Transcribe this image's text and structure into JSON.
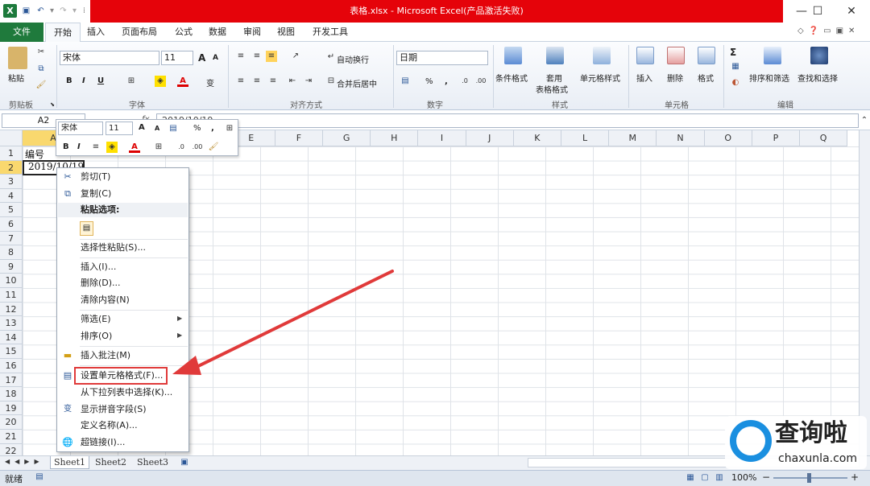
{
  "window": {
    "title": "表格.xlsx - Microsoft Excel(产品激活失败)",
    "app_icon": "X",
    "min": "—",
    "max": "☐",
    "close": "✕"
  },
  "tabs": [
    {
      "label": "文件"
    },
    {
      "label": "开始"
    },
    {
      "label": "插入"
    },
    {
      "label": "页面布局"
    },
    {
      "label": "公式"
    },
    {
      "label": "数据"
    },
    {
      "label": "审阅"
    },
    {
      "label": "视图"
    },
    {
      "label": "开发工具"
    }
  ],
  "ribbon": {
    "clipboard": {
      "label": "剪贴板",
      "paste": "粘贴"
    },
    "font": {
      "label": "字体",
      "name": "宋体",
      "size": "11",
      "bold": "B",
      "italic": "I",
      "underline": "U",
      "grow": "A",
      "shrink": "A",
      "phonetic": "变"
    },
    "align": {
      "label": "对齐方式",
      "wrap": "自动换行",
      "merge": "合并后居中"
    },
    "number": {
      "label": "数字",
      "format": "日期",
      "percent": "%",
      "comma": ","
    },
    "styles": {
      "label": "样式",
      "cond": "条件格式",
      "table1": "套用",
      "table2": "表格格式",
      "cell": "单元格样式"
    },
    "cells": {
      "label": "单元格",
      "insert": "插入",
      "delete": "删除",
      "format": "格式"
    },
    "edit": {
      "label": "编辑",
      "sort": "排序和筛选",
      "find": "查找和选择",
      "sum": "Σ"
    }
  },
  "formula": {
    "namebox": "A2",
    "fx": "fx",
    "value": "2019/10/19"
  },
  "columns": [
    "A",
    "B",
    "C",
    "D",
    "E",
    "F",
    "G",
    "H",
    "I",
    "J",
    "K",
    "L",
    "M",
    "N",
    "O",
    "P",
    "Q"
  ],
  "rows": [
    "1",
    "2",
    "3",
    "4",
    "5",
    "6",
    "7",
    "8",
    "9",
    "10",
    "11",
    "12",
    "13",
    "14",
    "15",
    "16",
    "17",
    "18",
    "19",
    "20",
    "21",
    "22"
  ],
  "cells": {
    "a1": "编号",
    "a2": "2019/10/19"
  },
  "mini_toolbar": {
    "font": "宋体",
    "size": "11",
    "bold": "B",
    "italic": "I",
    "percent": "%",
    "comma": ","
  },
  "context_menu": {
    "cut": "剪切(T)",
    "copy": "复制(C)",
    "paste_header": "粘贴选项:",
    "paste_special": "选择性粘贴(S)...",
    "insert": "插入(I)...",
    "delete": "删除(D)...",
    "clear": "清除内容(N)",
    "filter": "筛选(E)",
    "sort": "排序(O)",
    "comment": "插入批注(M)",
    "format_cells": "设置单元格格式(F)...",
    "pick_list": "从下拉列表中选择(K)...",
    "phonetic": "显示拼音字段(S)",
    "define_name": "定义名称(A)...",
    "hyperlink": "超链接(I)..."
  },
  "sheets": [
    "Sheet1",
    "Sheet2",
    "Sheet3"
  ],
  "status": {
    "ready": "就绪",
    "zoom": "100%",
    "minus": "−",
    "plus": "+"
  },
  "watermark": {
    "title": "查询啦",
    "url": "chaxunla.com"
  },
  "colors": {
    "title_bar": "#e5030a",
    "file_tab": "#1f7a3c",
    "arrow": "#e03a3a",
    "watermark": "#1a8fe0"
  }
}
